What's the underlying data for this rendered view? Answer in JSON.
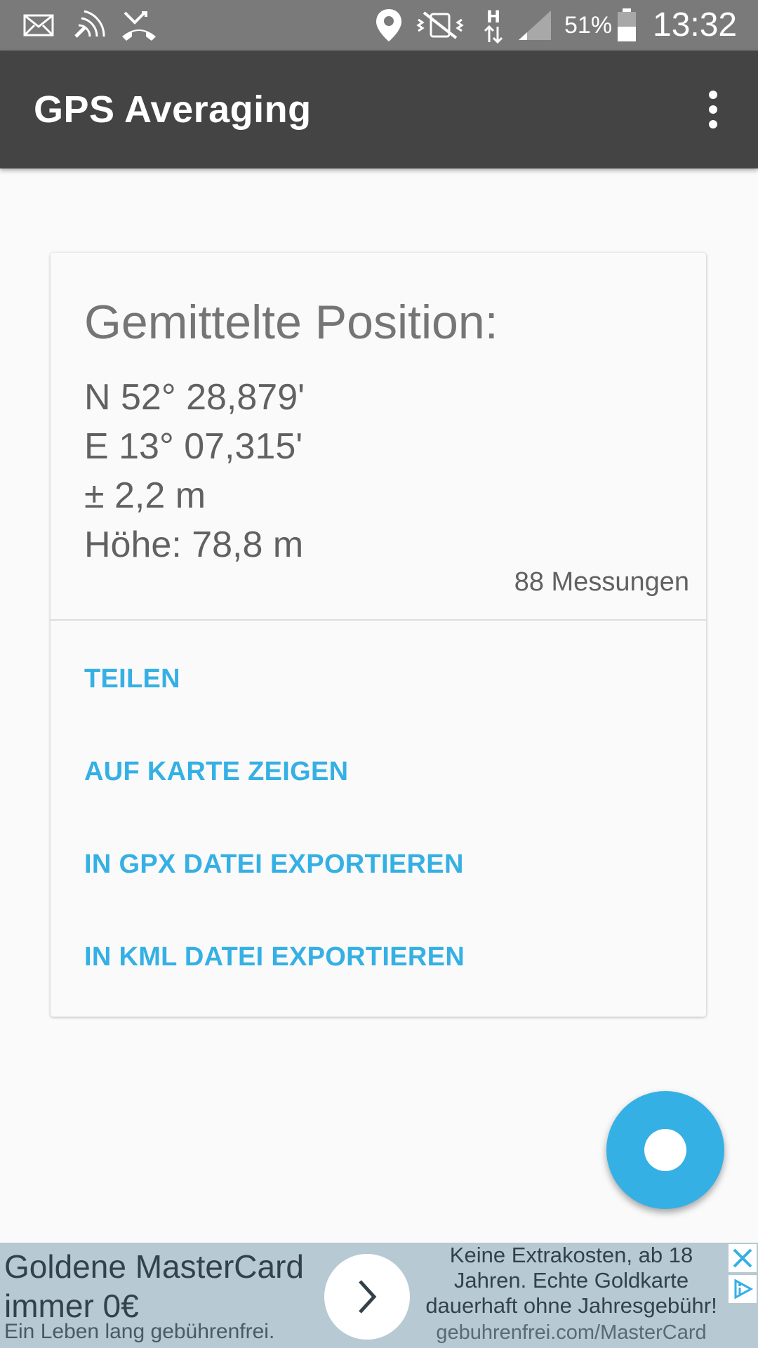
{
  "status_bar": {
    "icons_left": [
      "mail-icon",
      "nfc-icon",
      "missed-call-icon"
    ],
    "icons_right": [
      "location-icon",
      "vibrate-off-icon",
      "network-h-icon",
      "signal-icon",
      "battery-icon"
    ],
    "battery": "51%",
    "time": "13:32"
  },
  "app_bar": {
    "title": "GPS Averaging",
    "menu_icon": "more-vert-icon"
  },
  "card": {
    "title": "Gemittelte Position:",
    "latitude": "N 52° 28,879'",
    "longitude": "E 13° 07,315'",
    "accuracy": "± 2,2 m",
    "altitude": "Höhe: 78,8 m",
    "measurement_count": "88 Messungen",
    "actions": [
      {
        "label": "TEILEN"
      },
      {
        "label": "AUF KARTE ZEIGEN"
      },
      {
        "label": "IN GPX DATEI EXPORTIEREN"
      },
      {
        "label": "IN KML DATEI EXPORTIEREN"
      }
    ]
  },
  "fab": {
    "icon": "record-icon"
  },
  "ad": {
    "headline": "Goldene MasterCard immer 0€",
    "subline": "Ein Leben lang gebührenfrei.",
    "body": "Keine Extrakosten, ab 18 Jahren. Echte Goldkarte dauerhaft ohne Jahresgebühr!",
    "url": "gebuhrenfrei.com/MasterCard",
    "colors": {
      "accent": "#35b0e4",
      "appbar": "#444444",
      "ad_bg": "#b7c9d3"
    }
  }
}
